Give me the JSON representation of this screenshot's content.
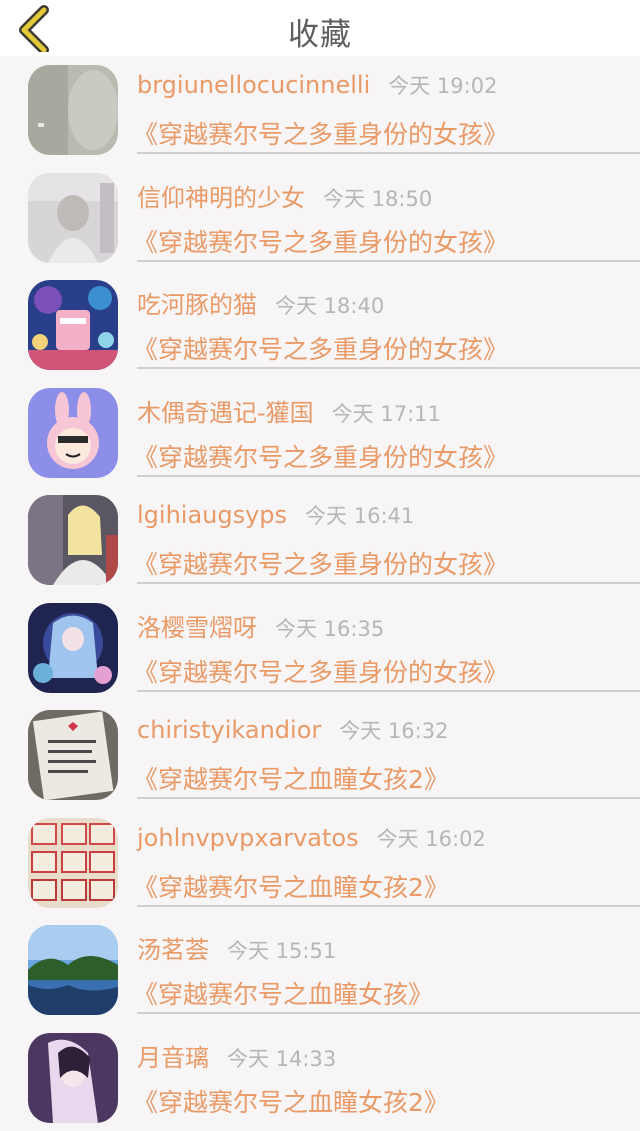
{
  "header": {
    "title": "收藏",
    "back_icon": "chevron-left-icon",
    "accent": "#e4c83a"
  },
  "colors": {
    "accent": "#e99a67",
    "time": "#b6b6b6",
    "background": "#f7f5f6"
  },
  "favorites": [
    {
      "username": "brgiunellocucinnelli",
      "time": "今天 19:02",
      "book": "《穿越赛尔号之多重身份的女孩》"
    },
    {
      "username": "信仰神明的少女",
      "time": "今天 18:50",
      "book": "《穿越赛尔号之多重身份的女孩》"
    },
    {
      "username": "吃河豚的猫",
      "time": "今天 18:40",
      "book": "《穿越赛尔号之多重身份的女孩》"
    },
    {
      "username": "木偶奇遇记-獾国",
      "time": "今天 17:11",
      "book": "《穿越赛尔号之多重身份的女孩》"
    },
    {
      "username": "lgihiaugsyps",
      "time": "今天 16:41",
      "book": "《穿越赛尔号之多重身份的女孩》"
    },
    {
      "username": "洛樱雪熠呀",
      "time": "今天 16:35",
      "book": "《穿越赛尔号之多重身份的女孩》"
    },
    {
      "username": "chiristyikandior",
      "time": "今天 16:32",
      "book": "《穿越赛尔号之血瞳女孩2》"
    },
    {
      "username": "johlnvpvpxarvatos",
      "time": "今天 16:02",
      "book": "《穿越赛尔号之血瞳女孩2》"
    },
    {
      "username": "汤茗荟",
      "time": "今天 15:51",
      "book": "《穿越赛尔号之血瞳女孩》"
    },
    {
      "username": "月音璃",
      "time": "今天 14:33",
      "book": "《穿越赛尔号之血瞳女孩2》"
    }
  ]
}
